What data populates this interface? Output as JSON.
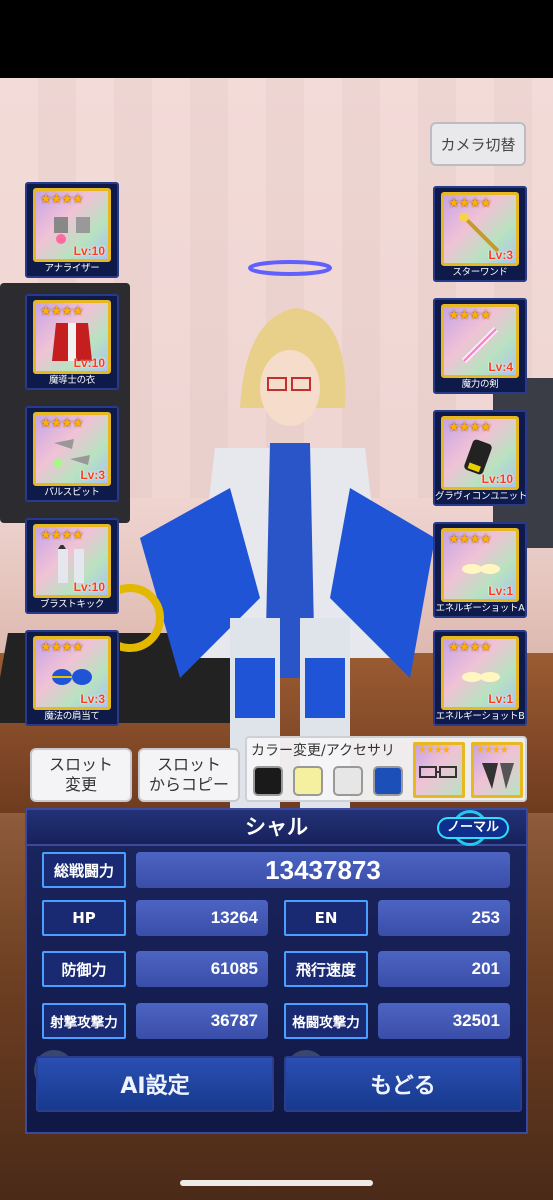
{
  "camera_button": "カメラ切替",
  "left_slots": [
    {
      "name": "アナライザー",
      "stars": "★★★★",
      "level": "Lv:10"
    },
    {
      "name": "魔導士の衣",
      "stars": "★★★★",
      "level": "Lv:10"
    },
    {
      "name": "パルスビット",
      "stars": "★★★★",
      "level": "Lv:3"
    },
    {
      "name": "ブラストキック",
      "stars": "★★★★",
      "level": "Lv:10"
    },
    {
      "name": "魔法の肩当て",
      "stars": "★★★★",
      "level": "Lv:3"
    }
  ],
  "right_slots": [
    {
      "name": "スターワンド",
      "stars": "★★★★",
      "level": "Lv:3"
    },
    {
      "name": "魔力の剣",
      "stars": "★★★★",
      "level": "Lv:4"
    },
    {
      "name": "グラヴィコンユニット",
      "stars": "★★★★",
      "level": "Lv:10"
    },
    {
      "name": "エネルギーショットA",
      "stars": "★★★★",
      "level": "Lv:1"
    },
    {
      "name": "エネルギーショットB",
      "stars": "★★★★",
      "level": "Lv:1"
    }
  ],
  "buttons": {
    "slot_change": "スロット\n変更",
    "slot_copy": "スロット\nからコピー"
  },
  "accessory": {
    "label": "カラー変更/アクセサリ",
    "swatches": [
      "#1a1a1a",
      "#f4f0a0",
      "#e6e6e6",
      "#1c4fb8"
    ],
    "cards": [
      {
        "stars": "★★★★",
        "icon": "glasses-icon"
      },
      {
        "stars": "★★★★",
        "icon": "hair-clip-icon"
      }
    ]
  },
  "character": {
    "name": "シャル",
    "rank": "ノーマル"
  },
  "stats": {
    "total_label": "総戦闘力",
    "total_value": "13437873",
    "hp_label": "HP",
    "hp_value": "13264",
    "en_label": "EN",
    "en_value": "253",
    "def_label": "防御力",
    "def_value": "61085",
    "speed_label": "飛行速度",
    "speed_value": "201",
    "shoot_label": "射撃攻撃力",
    "shoot_value": "36787",
    "melee_label": "格闘攻撃力",
    "melee_value": "32501"
  },
  "actions": {
    "ai_settings": "AI設定",
    "back": "もどる"
  }
}
